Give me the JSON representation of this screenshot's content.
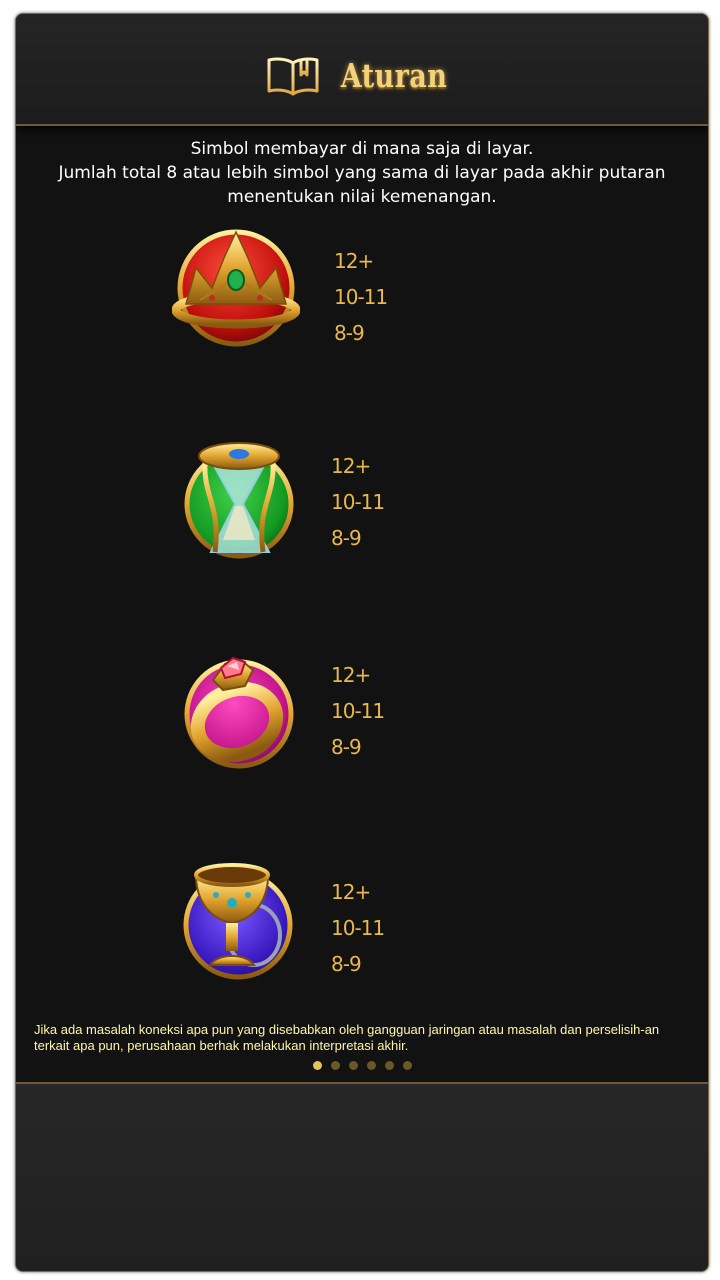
{
  "header": {
    "title": "Aturan",
    "icon": "book-icon"
  },
  "intro": {
    "lines": [
      "Simbol membayar di mana saja di layar.",
      "Jumlah total 8 atau lebih simbol yang sama di layar pada akhir putaran",
      "menentukan nilai kemenangan."
    ]
  },
  "symbols": [
    {
      "icon": "crown-icon",
      "pays": [
        "12+",
        "10-11",
        "8-9"
      ]
    },
    {
      "icon": "hourglass-icon",
      "pays": [
        "12+",
        "10-11",
        "8-9"
      ]
    },
    {
      "icon": "ring-icon",
      "pays": [
        "12+",
        "10-11",
        "8-9"
      ]
    },
    {
      "icon": "chalice-icon",
      "pays": [
        "12+",
        "10-11",
        "8-9"
      ]
    }
  ],
  "footer_note": "Jika ada masalah koneksi apa pun yang disebabkan oleh gangguan jaringan atau masalah dan perselisih-an terkait apa pun, perusahaan berhak melakukan interpretasi akhir.",
  "pagination": {
    "total": 6,
    "current": 1
  },
  "colors": {
    "accent_gold": "#e8b84a",
    "title_gold": "#f2d27a",
    "background": "#121212",
    "note_text": "#fff7a8"
  }
}
